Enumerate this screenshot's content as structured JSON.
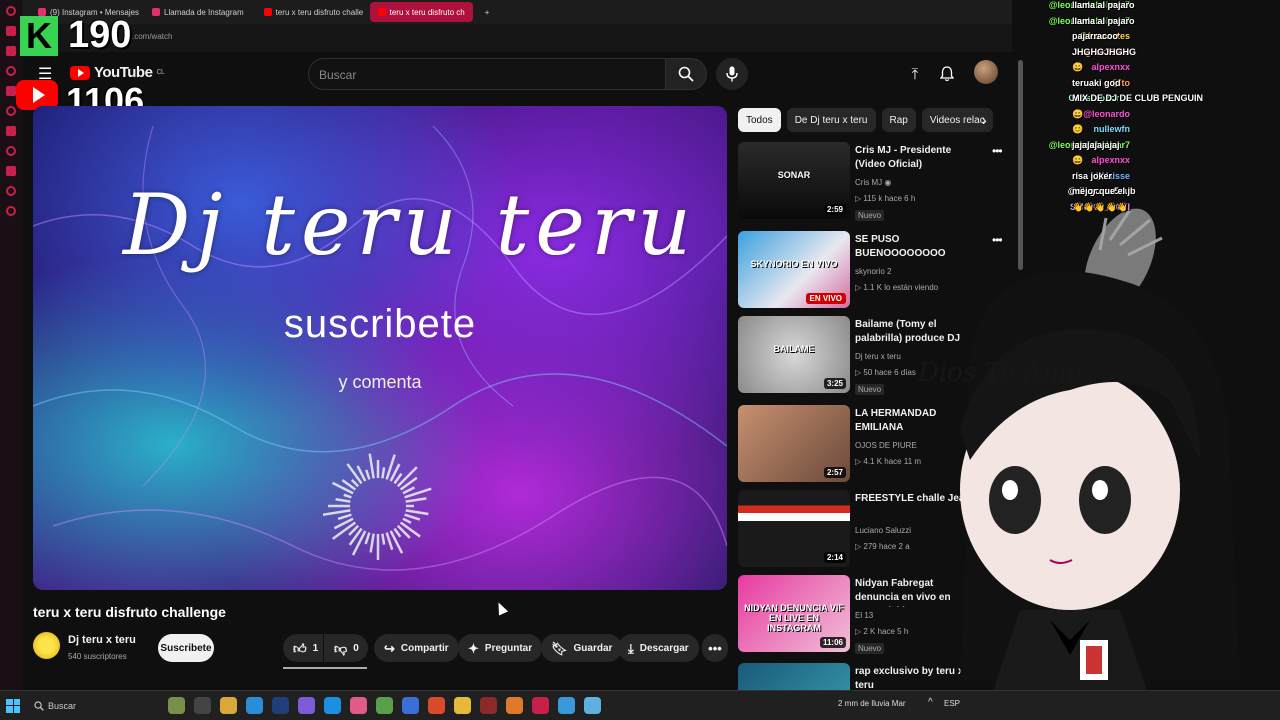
{
  "browser": {
    "tabs": [
      {
        "label": "(9) Instagram • Mensajes",
        "favicon": "instagram",
        "active": false
      },
      {
        "label": "Llamada de Instagram",
        "favicon": "instagram",
        "active": false
      },
      {
        "label": "teru x teru disfruto challe",
        "favicon": "youtube",
        "active": false
      },
      {
        "label": "teru x teru disfruto ch",
        "favicon": "youtube",
        "active": true
      }
    ],
    "new_tab": "+",
    "url_fragment": ".com/watch"
  },
  "stream_counters": {
    "kick_letter": "K",
    "kick_count": "190",
    "youtube_count": "1106"
  },
  "youtube": {
    "logo_text": "YouTube",
    "country": "CL",
    "search_placeholder": "Buscar",
    "video": {
      "overlay_title": "Dj teru teru",
      "overlay_sub": "suscribete",
      "overlay_sub2": "y comenta",
      "title": "teru x teru disfruto challenge",
      "channel": "Dj teru x teru",
      "subscribers": "540 suscriptores",
      "subscribe_label": "Suscribete",
      "likes": "1",
      "dislikes": "0",
      "share_label": "Compartir",
      "ask_label": "Preguntar",
      "save_label": "Guardar",
      "download_label": "Descargar"
    },
    "chips": [
      "Todos",
      "De Dj teru x teru",
      "Rap",
      "Videos relac"
    ],
    "recommendations": [
      {
        "title": "Cris MJ - Presidente (Video Oficial)",
        "channel": "Cris MJ ◉",
        "meta": "▷ 115 k  hace 6 h",
        "badge": "Nuevo",
        "duration": "2:59",
        "thumb_label": "SONAR"
      },
      {
        "title": "SE PUSO BUENOOOOOOOO PASEN AL DIRECTO DIOS T ...",
        "channel": "skynorio 2",
        "meta": "▷ 1.1 K lo están viendo",
        "badge": "",
        "duration": "EN VIVO",
        "thumb_label": "SKYNORIO EN VIVO"
      },
      {
        "title": "Bailame (Tomy el palabrilla) produce DJ teru ...",
        "channel": "Dj teru x teru",
        "meta": "▷ 50  hace 6 días",
        "badge": "Nuevo",
        "duration": "3:25",
        "thumb_label": "BAILAME"
      },
      {
        "title": "LA HERMANDAD EMILIANA",
        "channel": "OJOS DE PIURE",
        "meta": "▷ 4.1 K  hace 11 m",
        "badge": "",
        "duration": "2:57",
        "thumb_label": ""
      },
      {
        "title": "FREESTYLE challe Jean",
        "channel": "Luciano Saluzzi",
        "meta": "▷ 279  hace 2 a",
        "badge": "",
        "duration": "2:14",
        "thumb_label": ""
      },
      {
        "title": "Nidyan Fabregat denuncia en vivo en transmisión ...",
        "channel": "El 13",
        "meta": "▷ 2 K  hace 5 h",
        "badge": "Nuevo",
        "duration": "11:06",
        "thumb_label": "NIDYAN DENUNCIA VIF EN LIVE EN INSTAGRAM"
      },
      {
        "title": "rap exclusivo by teru x teru",
        "channel": "",
        "meta": "",
        "badge": "",
        "duration": "",
        "thumb_label": ""
      }
    ]
  },
  "chat": [
    {
      "user": "@leonardobelmar7",
      "text": "llama al pajaro",
      "color": "#7dff5a"
    },
    {
      "user": "@leonardobelmar7",
      "text": "llama al pajaro",
      "color": "#7dff5a"
    },
    {
      "user": "@lasonntes",
      "text": "pajarracoo",
      "color": "#ffd54a"
    },
    {
      "user": "raghar12326",
      "text": "JHGHGJHGHG",
      "color": "#ff6b6b"
    },
    {
      "user": "alpexnxx",
      "text": "😄",
      "color": "#ff4fd8"
    },
    {
      "user": "@ito",
      "text": "teruaki god",
      "color": "#ffa04a"
    },
    {
      "user": "Crisstophoros",
      "text": "MIX DE DJ DE CLUB PENGUIN",
      "color": "#7dffb0"
    },
    {
      "user": "@leonardo",
      "text": "😄",
      "color": "#ff4fd8"
    },
    {
      "user": "nullewfn",
      "text": "😊",
      "color": "#7ddcff"
    },
    {
      "user": "@leonardobelmar7",
      "text": "jajajajajajaj",
      "color": "#7dff5a"
    },
    {
      "user": "alpexnxx",
      "text": "😄",
      "color": "#ff4fd8"
    },
    {
      "user": "@Vaisse",
      "text": "risa joker",
      "color": "#7db0ff"
    },
    {
      "user": "@diego-ne5nu",
      "text": "mejor que el jb",
      "color": "#ffffff"
    },
    {
      "user": "SMOKE_BAKI",
      "text": "👋👋👋👋👋",
      "color": "#e28bff"
    }
  ],
  "overlay_text": "Dios Te Ama",
  "taskbar": {
    "search_label": "Buscar",
    "weather": "2 mm de lluvia Mar",
    "lang": "ESP"
  },
  "colors": {
    "accent": "#ff0000",
    "opera": "#b0103c",
    "kick": "#39d353"
  }
}
